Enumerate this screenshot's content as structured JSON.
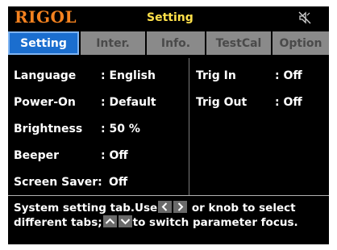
{
  "header": {
    "logo": "RIGOL",
    "title": "Setting",
    "status_icon": "speaker-muted-icon"
  },
  "tabs": [
    {
      "label": "Setting",
      "active": true
    },
    {
      "label": "Inter.",
      "active": false
    },
    {
      "label": "Info.",
      "active": false
    },
    {
      "label": "TestCal",
      "active": false
    },
    {
      "label": "Option",
      "active": false
    }
  ],
  "left_params": [
    {
      "label": "Language",
      "value": ": English"
    },
    {
      "label": "Power-On",
      "value": ": Default"
    },
    {
      "label": "Brightness",
      "value": ": 50 %"
    },
    {
      "label": "Beeper",
      "value": ": Off"
    },
    {
      "label": "Screen Saver:",
      "value": "Off"
    }
  ],
  "right_params": [
    {
      "label": "Trig In",
      "value": ": Off"
    },
    {
      "label": "Trig Out",
      "value": ": Off"
    }
  ],
  "help": {
    "part1": "System setting tab.Use",
    "part2": "or knob to select",
    "part3": "different tabs;",
    "part4": "to switch parameter focus."
  },
  "colors": {
    "background": "#000000",
    "logo": "#f5821f",
    "title": "#ffe14a",
    "active_tab": "#1b6ecf",
    "inactive_tab": "#8a8a8a"
  }
}
